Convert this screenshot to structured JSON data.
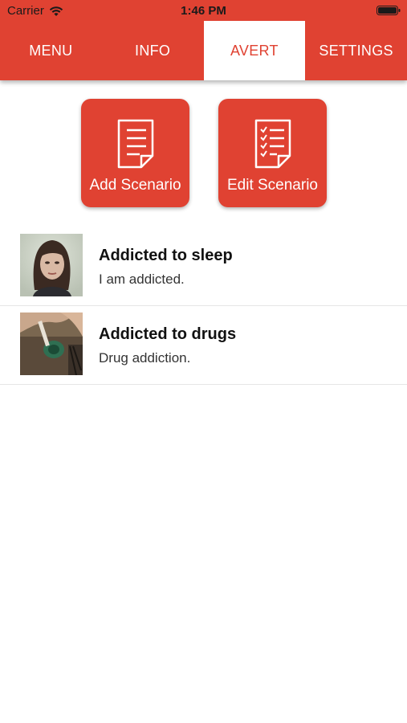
{
  "status_bar": {
    "carrier": "Carrier",
    "time": "1:46 PM"
  },
  "tabs": [
    {
      "label": "MENU",
      "active": false
    },
    {
      "label": "INFO",
      "active": false
    },
    {
      "label": "AVERT",
      "active": true
    },
    {
      "label": "SETTINGS",
      "active": false
    }
  ],
  "actions": {
    "add_label": "Add Scenario",
    "add_icon": "document-lines-icon",
    "edit_label": "Edit Scenario",
    "edit_icon": "checklist-document-icon"
  },
  "scenarios": [
    {
      "title": "Addicted to sleep",
      "description": "I am addicted.",
      "thumbnail": "woman-portrait-photo"
    },
    {
      "title": "Addicted to drugs",
      "description": "Drug addiction.",
      "thumbnail": "drug-use-photo"
    }
  ],
  "colors": {
    "accent": "#e04232",
    "background": "#ffffff"
  }
}
